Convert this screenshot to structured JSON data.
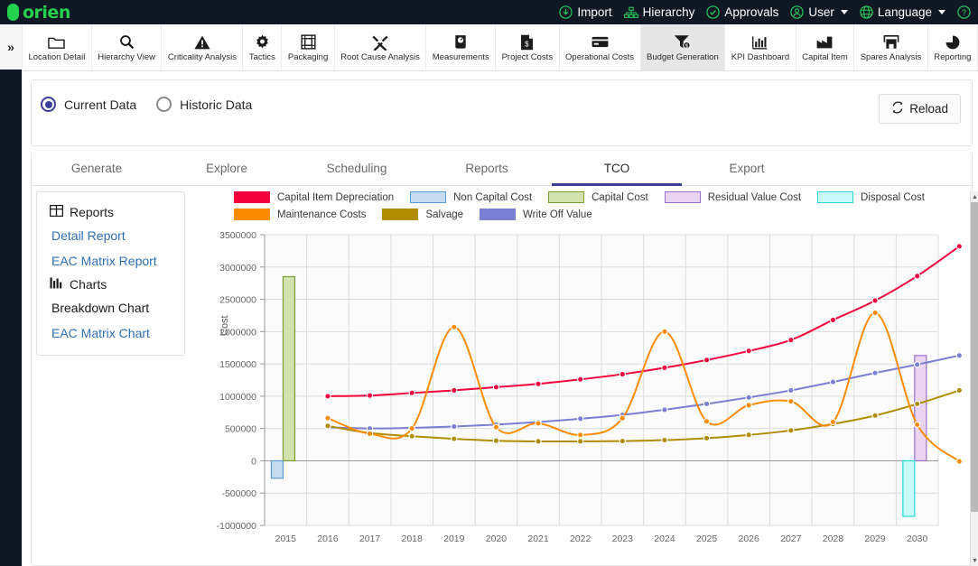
{
  "app": {
    "logo_text": "orien"
  },
  "topnav": [
    {
      "label": "Import",
      "icon": "import-icon"
    },
    {
      "label": "Hierarchy",
      "icon": "hierarchy-icon"
    },
    {
      "label": "Approvals",
      "icon": "approvals-check-icon"
    },
    {
      "label": "User",
      "icon": "user-icon",
      "caret": true
    },
    {
      "label": "Language",
      "icon": "globe-icon",
      "caret": true
    },
    {
      "label": "",
      "icon": "help-icon"
    }
  ],
  "rail": {
    "expand_label": "»"
  },
  "ribbon": {
    "items": [
      {
        "label": "Location Detail",
        "icon": "folder-icon",
        "active": false
      },
      {
        "label": "Hierarchy View",
        "icon": "search-icon",
        "active": false
      },
      {
        "label": "Criticality Analysis",
        "icon": "warning-triangle-icon",
        "active": false
      },
      {
        "label": "Tactics",
        "icon": "gear-icon",
        "active": false
      },
      {
        "label": "Packaging",
        "icon": "package-icon",
        "active": false
      },
      {
        "label": "Root Cause Analysis",
        "icon": "tools-icon",
        "active": false
      },
      {
        "label": "Measurements",
        "icon": "gauge-icon",
        "active": false
      },
      {
        "label": "Project Costs",
        "icon": "document-dollar-icon",
        "active": false
      },
      {
        "label": "Operational Costs",
        "icon": "card-icon",
        "active": false
      },
      {
        "label": "Budget Generation",
        "icon": "funnel-dollar-icon",
        "active": true
      },
      {
        "label": "KPI Dashboard",
        "icon": "bar-chart-icon",
        "active": false
      },
      {
        "label": "Capital Item",
        "icon": "factory-icon",
        "active": false
      },
      {
        "label": "Spares Analysis",
        "icon": "warehouse-icon",
        "active": false
      },
      {
        "label": "Reporting",
        "icon": "pie-chart-icon",
        "active": false
      }
    ]
  },
  "data_scope": {
    "options": [
      {
        "label": "Current Data",
        "selected": true
      },
      {
        "label": "Historic Data",
        "selected": false
      }
    ],
    "reload_label": "Reload",
    "reload_icon": "refresh-icon"
  },
  "tabs": [
    {
      "label": "Generate",
      "active": false
    },
    {
      "label": "Explore",
      "active": false
    },
    {
      "label": "Scheduling",
      "active": false
    },
    {
      "label": "Reports",
      "active": false
    },
    {
      "label": "TCO",
      "active": true
    },
    {
      "label": "Export",
      "active": false
    }
  ],
  "sidepanel": {
    "groups": [
      {
        "title": "Reports",
        "icon": "table-icon",
        "items": [
          {
            "label": "Detail Report",
            "current": false
          },
          {
            "label": "EAC Matrix Report",
            "current": false
          }
        ]
      },
      {
        "title": "Charts",
        "icon": "chart-icon",
        "items": [
          {
            "label": "Breakdown Chart",
            "current": true
          },
          {
            "label": "EAC Matrix Chart",
            "current": false
          }
        ]
      }
    ]
  },
  "scrollbar": {
    "up_arrow": "▲",
    "down_arrow": "▼"
  },
  "chart_data": {
    "type": "line",
    "title": "",
    "xlabel": "",
    "ylabel": "Cost",
    "ylim": [
      -1000000,
      3500000
    ],
    "ytick_step": 500000,
    "yticks": [
      3500000,
      3000000,
      2500000,
      2000000,
      1500000,
      1000000,
      500000,
      0,
      -500000,
      -1000000
    ],
    "ytick_labels": [
      "3500000",
      "3000000",
      "2500000",
      "2000000",
      "1500000",
      "1000000",
      "500000",
      "0",
      "-500000",
      "-1000000"
    ],
    "categories": [
      2015,
      2016,
      2017,
      2018,
      2019,
      2020,
      2021,
      2022,
      2023,
      2024,
      2025,
      2026,
      2027,
      2028,
      2029,
      2030
    ],
    "xtick_labels": [
      "2015",
      "2016",
      "2017",
      "2018",
      "2019",
      "2020",
      "2021",
      "2022",
      "2023",
      "2024",
      "2025",
      "2026",
      "2027",
      "2028",
      "2029",
      "2030"
    ],
    "grid": true,
    "legend_position": "top",
    "colors": {
      "capital_item_depreciation": "#f4003c",
      "non_capital_cost": "#c5dcf0",
      "non_capital_cost_border": "#5b9bd5",
      "capital_cost": "#d3e3b0",
      "capital_cost_border": "#7a9e33",
      "residual_value_cost": "#e9d5f0",
      "residual_value_cost_border": "#9b6fd0",
      "disposal_cost": "#c9fbfb",
      "disposal_cost_border": "#25d8e0",
      "maintenance_costs": "#ff8c00",
      "salvage": "#b08d00",
      "write_off_value": "#7b7fd4"
    },
    "legend": [
      {
        "name": "Capital Item Depreciation",
        "color": "#f4003c",
        "style": "solid"
      },
      {
        "name": "Non Capital Cost",
        "color": "#c5dcf0",
        "style": "outlined",
        "border": "#5b9bd5"
      },
      {
        "name": "Capital Cost",
        "color": "#d3e3b0",
        "style": "outlined",
        "border": "#7a9e33"
      },
      {
        "name": "Residual Value Cost",
        "color": "#e9d5f0",
        "style": "outlined",
        "border": "#9b6fd0"
      },
      {
        "name": "Disposal Cost",
        "color": "#c9fbfb",
        "style": "outlined",
        "border": "#25d8e0"
      },
      {
        "name": "Maintenance Costs",
        "color": "#ff8c00",
        "style": "solid"
      },
      {
        "name": "Salvage",
        "color": "#b08d00",
        "style": "solid"
      },
      {
        "name": "Write Off Value",
        "color": "#7b7fd4",
        "style": "solid"
      }
    ],
    "series": [
      {
        "name": "Capital Item Depreciation",
        "kind": "line",
        "color": "#f4003c",
        "values": [
          null,
          1000000,
          1010000,
          1050000,
          1090000,
          1140000,
          1190000,
          1260000,
          1340000,
          1440000,
          1560000,
          1700000,
          1870000,
          2180000,
          2480000,
          2860000,
          3320000
        ]
      },
      {
        "name": "Write Off Value",
        "kind": "line",
        "color": "#7b7fd4",
        "values": [
          null,
          520000,
          500000,
          510000,
          530000,
          560000,
          600000,
          650000,
          710000,
          790000,
          880000,
          980000,
          1090000,
          1220000,
          1360000,
          1490000,
          1630000
        ]
      },
      {
        "name": "Salvage",
        "kind": "line",
        "color": "#b08d00",
        "values": [
          null,
          540000,
          430000,
          380000,
          340000,
          310000,
          300000,
          300000,
          305000,
          320000,
          350000,
          400000,
          470000,
          570000,
          700000,
          880000,
          1090000
        ]
      },
      {
        "name": "Maintenance Costs",
        "kind": "line",
        "color": "#ff8c00",
        "values": [
          null,
          660000,
          420000,
          500000,
          2070000,
          520000,
          580000,
          400000,
          660000,
          2000000,
          610000,
          860000,
          920000,
          600000,
          2290000,
          560000,
          -10000
        ]
      },
      {
        "name": "Capital Cost",
        "kind": "bar",
        "color": "#d3e3b0",
        "border": "#7a9e33",
        "values": [
          2850000,
          0,
          0,
          0,
          0,
          0,
          0,
          0,
          0,
          0,
          0,
          0,
          0,
          0,
          0,
          0
        ]
      },
      {
        "name": "Non Capital Cost",
        "kind": "bar",
        "color": "#c5dcf0",
        "border": "#5b9bd5",
        "values": [
          -270000,
          0,
          0,
          0,
          0,
          0,
          0,
          0,
          0,
          0,
          0,
          0,
          0,
          0,
          0,
          0
        ]
      },
      {
        "name": "Residual Value Cost",
        "kind": "bar",
        "color": "#e9d5f0",
        "border": "#9b6fd0",
        "values": [
          0,
          0,
          0,
          0,
          0,
          0,
          0,
          0,
          0,
          0,
          0,
          0,
          0,
          0,
          0,
          1630000
        ]
      },
      {
        "name": "Disposal Cost",
        "kind": "bar",
        "color": "#c9fbfb",
        "border": "#25d8e0",
        "values": [
          0,
          0,
          0,
          0,
          0,
          0,
          0,
          0,
          0,
          0,
          0,
          0,
          0,
          0,
          0,
          -860000
        ]
      }
    ]
  }
}
